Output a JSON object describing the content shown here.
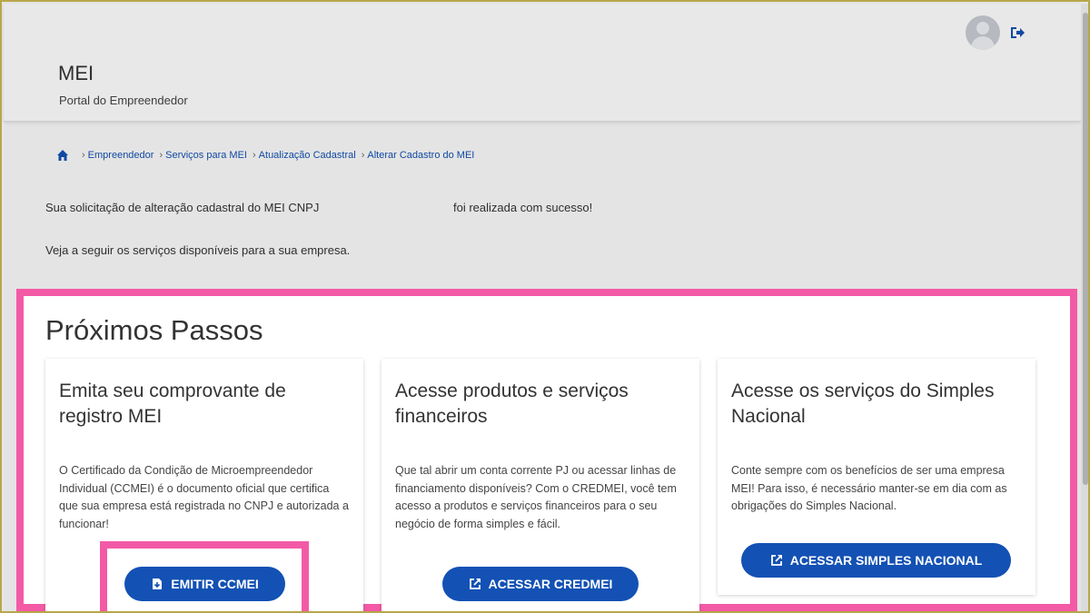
{
  "header": {
    "title": "MEI",
    "subtitle": "Portal do Empreendedor"
  },
  "breadcrumb": [
    "Empreendedor",
    "Serviços para MEI",
    "Atualização Cadastral",
    "Alterar Cadastro do MEI"
  ],
  "messages": {
    "line1_start": "Sua solicitação de alteração cadastral do MEI CNPJ",
    "line1_end": "foi realizada com sucesso!",
    "line2": "Veja a seguir os serviços disponíveis para a sua empresa."
  },
  "panel": {
    "title": "Próximos Passos",
    "cards": [
      {
        "title": "Emita seu comprovante de registro MEI",
        "text": "O Certificado da Condição de Microempreendedor Individual (CCMEI) é o documento oficial que certifica que sua empresa está registrada no CNPJ e autorizada a funcionar!",
        "button": "EMITIR CCMEI"
      },
      {
        "title": "Acesse produtos e serviços financeiros",
        "text": "Que tal abrir um conta corrente PJ ou acessar linhas de financiamento disponíveis? Com o CREDMEI, você tem acesso a produtos e serviços financeiros para o seu negócio de forma simples e fácil.",
        "button": "ACESSAR CREDMEI"
      },
      {
        "title": "Acesse os serviços do Simples Nacional",
        "text": "Conte sempre com os benefícios de ser uma empresa MEI! Para isso, é necessário manter-se em dia com as obrigações do Simples Nacional.",
        "button": "ACESSAR SIMPLES NACIONAL"
      }
    ]
  },
  "icons": {
    "home": "home-icon",
    "logout": "logout-icon",
    "avatar": "user-avatar",
    "download": "file-download-icon",
    "external": "external-link-icon"
  },
  "colors": {
    "primary": "#1351b4",
    "highlight": "#f35aa6"
  }
}
